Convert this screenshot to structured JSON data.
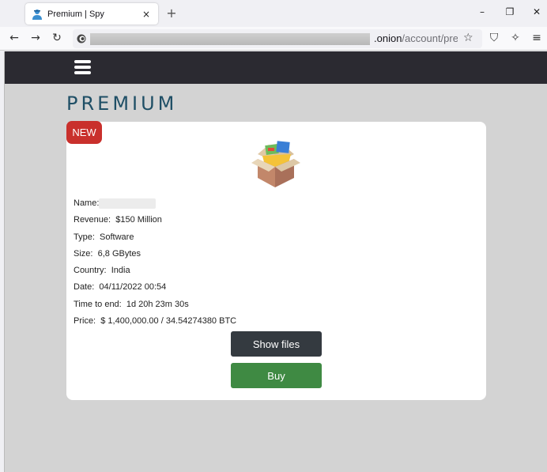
{
  "browser": {
    "tab_title": "Premium | Spy",
    "tab_close": "×",
    "new_tab": "+",
    "minimize": "–",
    "maximize": "❐",
    "close": "✕",
    "back": "←",
    "forward": "→",
    "reload": "↻",
    "url_host": ".onion",
    "url_path": "/account/pre",
    "star": "☆",
    "shield": "⛉",
    "extension": "✧",
    "menu": "≡"
  },
  "page": {
    "title": "PREMIUM",
    "badge": "NEW",
    "details": [
      {
        "label": "Name:",
        "value": ""
      },
      {
        "label": "Revenue:",
        "value": "$150 Million"
      },
      {
        "label": "Type:",
        "value": "Software"
      },
      {
        "label": "Size:",
        "value": "6,8 GBytes"
      },
      {
        "label": "Country:",
        "value": "India"
      },
      {
        "label": "Date:",
        "value": "04/11/2022 00:54"
      },
      {
        "label": "Time to end:",
        "value": "1d 20h 23m 30s"
      },
      {
        "label": "Price:",
        "value": "$ 1,400,000.00 / 34.54274380 BTC"
      }
    ],
    "show_files_label": "Show files",
    "buy_label": "Buy"
  }
}
